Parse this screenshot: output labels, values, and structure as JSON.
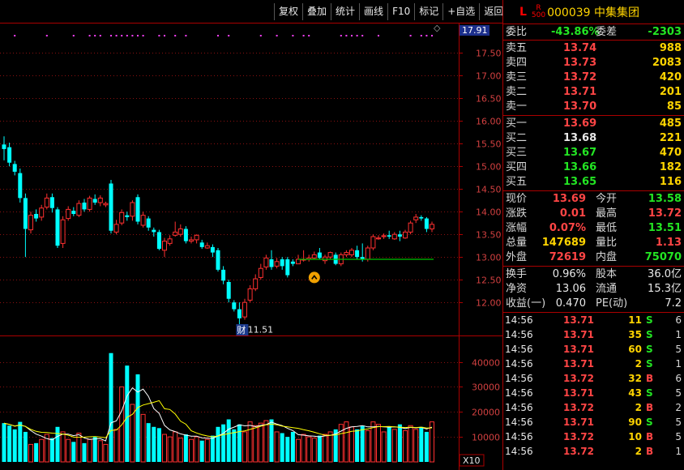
{
  "toolbar": {
    "buttons": [
      "复权",
      "叠加",
      "统计",
      "画线",
      "F10",
      "标记",
      "+自选",
      "返回"
    ]
  },
  "chart": {
    "price_axis_labels": [
      "17.50",
      "17.00",
      "16.50",
      "16.00",
      "15.50",
      "15.00",
      "14.50",
      "14.00",
      "13.50",
      "13.00",
      "12.50",
      "12.00"
    ],
    "price_tag": "17.91",
    "low_marker": "←11.51",
    "financial_flag": "财",
    "vol_axis_labels": [
      "40000",
      "30000",
      "20000",
      "10000"
    ],
    "vol_unit": "X10",
    "colors": {
      "up": "#ff3030",
      "down": "#00ffff",
      "ma": "#ffffff",
      "ma2": "#ffff00",
      "support": "#00c000"
    }
  },
  "chart_data": {
    "type": "candlestick",
    "ohlc": [
      [
        15.48,
        15.38,
        15.66,
        15.13
      ],
      [
        15.42,
        15.08,
        15.52,
        15.0
      ],
      [
        15.05,
        14.88,
        15.12,
        14.8
      ],
      [
        14.85,
        14.3,
        14.95,
        14.2
      ],
      [
        14.3,
        13.62,
        14.4,
        13.0
      ],
      [
        13.6,
        13.92,
        14.0,
        13.52
      ],
      [
        13.95,
        13.85,
        14.05,
        13.78
      ],
      [
        13.88,
        14.08,
        14.15,
        13.8
      ],
      [
        14.1,
        14.3,
        14.4,
        14.05
      ],
      [
        14.32,
        14.08,
        14.4,
        13.98
      ],
      [
        14.05,
        13.25,
        14.1,
        13.2
      ],
      [
        13.3,
        13.82,
        13.9,
        13.2
      ],
      [
        13.85,
        14.05,
        14.12,
        13.8
      ],
      [
        14.02,
        13.95,
        14.1,
        13.9
      ],
      [
        13.92,
        14.18,
        14.25,
        13.88
      ],
      [
        14.2,
        14.05,
        14.28,
        14.0
      ],
      [
        14.05,
        14.3,
        14.35,
        14.0
      ],
      [
        14.28,
        14.2,
        14.38,
        14.15
      ],
      [
        14.2,
        14.3,
        14.36,
        14.12
      ],
      [
        14.15,
        14.18,
        14.22,
        14.1
      ],
      [
        14.62,
        13.58,
        14.7,
        13.52
      ],
      [
        13.55,
        13.72,
        13.82,
        13.5
      ],
      [
        13.75,
        13.98,
        14.05,
        13.7
      ],
      [
        13.92,
        13.88,
        14.0,
        13.8
      ],
      [
        13.9,
        14.2,
        14.25,
        13.8
      ],
      [
        14.32,
        13.78,
        14.38,
        13.72
      ],
      [
        13.7,
        13.92,
        14.0,
        13.65
      ],
      [
        13.85,
        13.65,
        13.9,
        13.58
      ],
      [
        13.6,
        13.55,
        13.65,
        13.45
      ],
      [
        13.55,
        13.18,
        13.6,
        13.15
      ],
      [
        13.15,
        13.35,
        13.42,
        13.0
      ],
      [
        13.3,
        13.4,
        13.48,
        13.25
      ],
      [
        13.48,
        13.55,
        13.78,
        13.45
      ],
      [
        13.5,
        13.62,
        13.72,
        13.45
      ],
      [
        13.62,
        13.35,
        13.68,
        13.3
      ],
      [
        13.35,
        13.38,
        13.45,
        13.3
      ],
      [
        13.38,
        13.48,
        13.5,
        13.3
      ],
      [
        13.32,
        13.22,
        13.38,
        13.18
      ],
      [
        13.2,
        13.25,
        13.32,
        13.18
      ],
      [
        13.22,
        13.1,
        13.28,
        13.0
      ],
      [
        13.15,
        12.72,
        13.2,
        12.68
      ],
      [
        12.72,
        12.48,
        12.8,
        12.4
      ],
      [
        12.45,
        12.08,
        12.5,
        12.0
      ],
      [
        12.0,
        11.85,
        12.05,
        11.8
      ],
      [
        11.85,
        11.65,
        12.0,
        11.51
      ],
      [
        11.68,
        12.0,
        12.08,
        11.62
      ],
      [
        12.05,
        12.3,
        12.38,
        12.0
      ],
      [
        12.3,
        12.52,
        12.62,
        12.25
      ],
      [
        12.55,
        12.75,
        12.85,
        12.5
      ],
      [
        12.78,
        12.98,
        13.05,
        12.72
      ],
      [
        12.95,
        12.78,
        13.15,
        12.72
      ],
      [
        12.8,
        12.9,
        12.98,
        12.75
      ],
      [
        12.95,
        12.8,
        13.0,
        12.72
      ],
      [
        12.95,
        12.6,
        13.0,
        12.55
      ],
      [
        12.9,
        12.85,
        12.95,
        12.8
      ],
      [
        12.85,
        12.95,
        13.05,
        12.85
      ],
      [
        12.95,
        12.95,
        13.15,
        12.9
      ],
      [
        12.95,
        12.98,
        13.05,
        12.9
      ],
      [
        12.98,
        13.05,
        13.12,
        12.95
      ],
      [
        13.1,
        12.98,
        13.2,
        12.95
      ],
      [
        12.92,
        13.0,
        13.05,
        12.85
      ],
      [
        13.0,
        13.1,
        13.12,
        12.95
      ],
      [
        13.05,
        12.85,
        13.1,
        12.82
      ],
      [
        12.85,
        13.05,
        13.1,
        12.8
      ],
      [
        13.05,
        13.1,
        13.15,
        13.0
      ],
      [
        13.05,
        13.15,
        13.2,
        13.0
      ],
      [
        13.15,
        13.0,
        13.25,
        12.95
      ],
      [
        13.0,
        12.95,
        13.3,
        12.9
      ],
      [
        12.95,
        13.2,
        13.25,
        12.9
      ],
      [
        13.2,
        13.45,
        13.5,
        13.15
      ],
      [
        13.4,
        13.42,
        13.48,
        13.38
      ],
      [
        13.45,
        13.47,
        13.52,
        13.4
      ],
      [
        13.48,
        13.45,
        13.58,
        13.4
      ],
      [
        13.4,
        13.5,
        13.55,
        13.38
      ],
      [
        13.5,
        13.45,
        13.58,
        13.35
      ],
      [
        13.42,
        13.55,
        13.6,
        13.4
      ],
      [
        13.55,
        13.75,
        13.8,
        13.5
      ],
      [
        13.82,
        13.88,
        13.95,
        13.75
      ],
      [
        13.88,
        13.85,
        13.92,
        13.8
      ],
      [
        13.85,
        13.62,
        13.88,
        13.55
      ],
      [
        13.62,
        13.72,
        13.78,
        13.55
      ]
    ],
    "volume": [
      15500,
      14500,
      13000,
      16000,
      12000,
      7000,
      7500,
      9000,
      11000,
      9500,
      14000,
      12000,
      9000,
      8000,
      11500,
      7500,
      9000,
      10000,
      8500,
      7000,
      43500,
      13000,
      30000,
      38500,
      23000,
      35000,
      19000,
      15500,
      14000,
      13500,
      11000,
      10000,
      12000,
      9500,
      11000,
      9000,
      10000,
      8500,
      9000,
      10500,
      14000,
      15000,
      17000,
      13000,
      15000,
      12000,
      16000,
      14500,
      15500,
      16500,
      17000,
      12000,
      11500,
      10000,
      12000,
      9000,
      11000,
      10000,
      9500,
      10500,
      11000,
      12000,
      13000,
      15000,
      16000,
      14000,
      13000,
      14500,
      12500,
      16000,
      15000,
      12000,
      14000,
      13000,
      15000,
      12500,
      14500,
      13000,
      14000,
      12000,
      16000
    ],
    "support_level": 12.95,
    "ylim_price": [
      11.45,
      17.95
    ],
    "ylim_volume": [
      0,
      46000
    ]
  },
  "quote": {
    "stock": {
      "l": "L",
      "r_top": "R",
      "r_bottom": "500",
      "code_name": "000039 中集集团"
    },
    "weibi": {
      "label": "委比",
      "value": "-43.86%",
      "label2": "委差",
      "value2": "-2303"
    },
    "sells": [
      {
        "label": "卖五",
        "price": "13.74",
        "vol": "988"
      },
      {
        "label": "卖四",
        "price": "13.73",
        "vol": "2083"
      },
      {
        "label": "卖三",
        "price": "13.72",
        "vol": "420"
      },
      {
        "label": "卖二",
        "price": "13.71",
        "vol": "201"
      },
      {
        "label": "卖一",
        "price": "13.70",
        "vol": "85"
      }
    ],
    "buys": [
      {
        "label": "买一",
        "price": "13.69",
        "vol": "485"
      },
      {
        "label": "买二",
        "price": "13.68",
        "vol": "221"
      },
      {
        "label": "买三",
        "price": "13.67",
        "vol": "470"
      },
      {
        "label": "买四",
        "price": "13.66",
        "vol": "182"
      },
      {
        "label": "买五",
        "price": "13.65",
        "vol": "116"
      }
    ],
    "stats1": [
      {
        "l1": "现价",
        "v1": "13.69",
        "l2": "今开",
        "v2": "13.58"
      },
      {
        "l1": "涨跌",
        "v1": "0.01",
        "l2": "最高",
        "v2": "13.72"
      },
      {
        "l1": "涨幅",
        "v1": "0.07%",
        "l2": "最低",
        "v2": "13.51"
      },
      {
        "l1": "总量",
        "v1": "147689",
        "l2": "量比",
        "v2": "1.13"
      },
      {
        "l1": "外盘",
        "v1": "72619",
        "l2": "内盘",
        "v2": "75070"
      }
    ],
    "stats2": [
      {
        "l1": "换手",
        "v1": "0.96%",
        "l2": "股本",
        "v2": "36.0亿"
      },
      {
        "l1": "净资",
        "v1": "13.06",
        "l2": "流通",
        "v2": "15.3亿"
      },
      {
        "l1": "收益(一)",
        "v1": "0.470",
        "l2": "PE(动)",
        "v2": "7.2"
      }
    ],
    "ticks": [
      {
        "time": "14:56",
        "price": "13.71",
        "vol": "11",
        "side": "S",
        "num": "6"
      },
      {
        "time": "14:56",
        "price": "13.71",
        "vol": "35",
        "side": "S",
        "num": "1"
      },
      {
        "time": "14:56",
        "price": "13.71",
        "vol": "60",
        "side": "S",
        "num": "5"
      },
      {
        "time": "14:56",
        "price": "13.71",
        "vol": "2",
        "side": "S",
        "num": "1"
      },
      {
        "time": "14:56",
        "price": "13.72",
        "vol": "32",
        "side": "B",
        "num": "6"
      },
      {
        "time": "14:56",
        "price": "13.71",
        "vol": "43",
        "side": "S",
        "num": "5"
      },
      {
        "time": "14:56",
        "price": "13.72",
        "vol": "2",
        "side": "B",
        "num": "2"
      },
      {
        "time": "14:56",
        "price": "13.71",
        "vol": "90",
        "side": "S",
        "num": "5"
      },
      {
        "time": "14:56",
        "price": "13.72",
        "vol": "10",
        "side": "B",
        "num": "5"
      },
      {
        "time": "14:56",
        "price": "13.72",
        "vol": "2",
        "side": "B",
        "num": "1"
      }
    ]
  }
}
